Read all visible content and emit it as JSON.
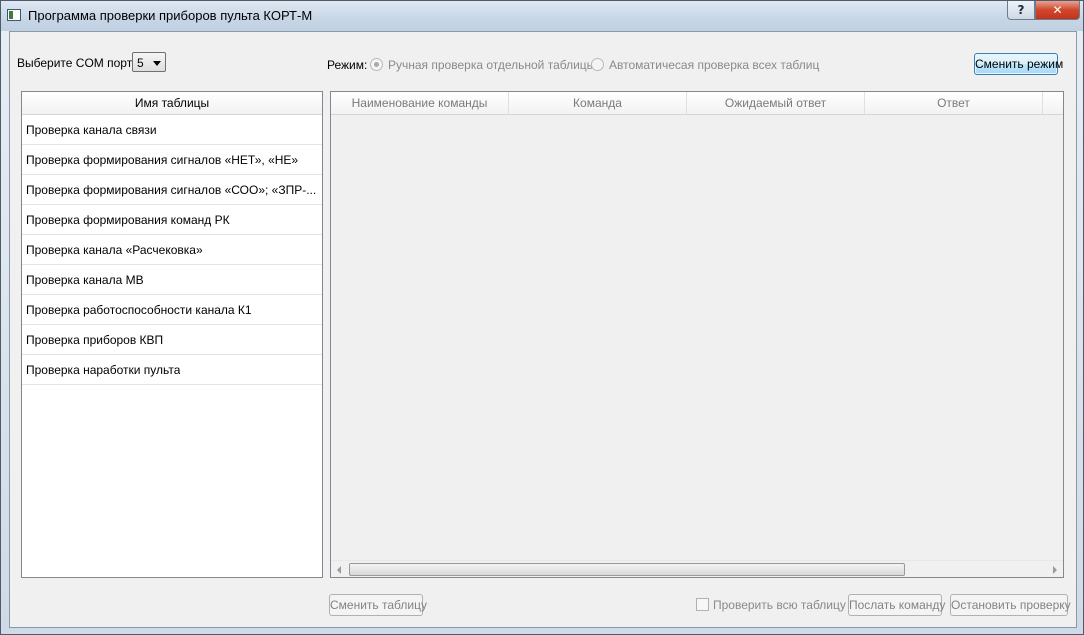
{
  "window": {
    "title": "Программа проверки приборов пульта КОРТ-М",
    "help_label": "?",
    "close_label": "✕"
  },
  "com_port": {
    "label": "Выберите COM порт:",
    "selected": "5"
  },
  "mode": {
    "label": "Режим:",
    "options": [
      {
        "label": "Ручная проверка отдельной таблицы",
        "checked": true
      },
      {
        "label": "Автоматичесая проверка всех таблиц",
        "checked": false
      }
    ],
    "switch_button": "Сменить режим"
  },
  "tables_list": {
    "header": "Имя таблицы",
    "items": [
      "Проверка канала связи",
      "Проверка формирования сигналов «НЕТ», «НЕ»",
      "Проверка формирования сигналов «СОО»; «ЗПР-...",
      "Проверка формирования команд РК",
      "Проверка канала «Расчековка»",
      "Проверка канала МВ",
      "Проверка работоспособности канала К1",
      "Проверка приборов КВП",
      "Проверка наработки пульта"
    ]
  },
  "commands_table": {
    "columns": [
      "Наименование команды",
      "Команда",
      "Ожидаемый ответ",
      "Ответ"
    ]
  },
  "bottom": {
    "change_table_button": "Сменить таблицу",
    "check_all_label": "Проверить всю таблицу",
    "send_command_button": "Послать команду",
    "stop_check_button": "Остановить проверку"
  }
}
